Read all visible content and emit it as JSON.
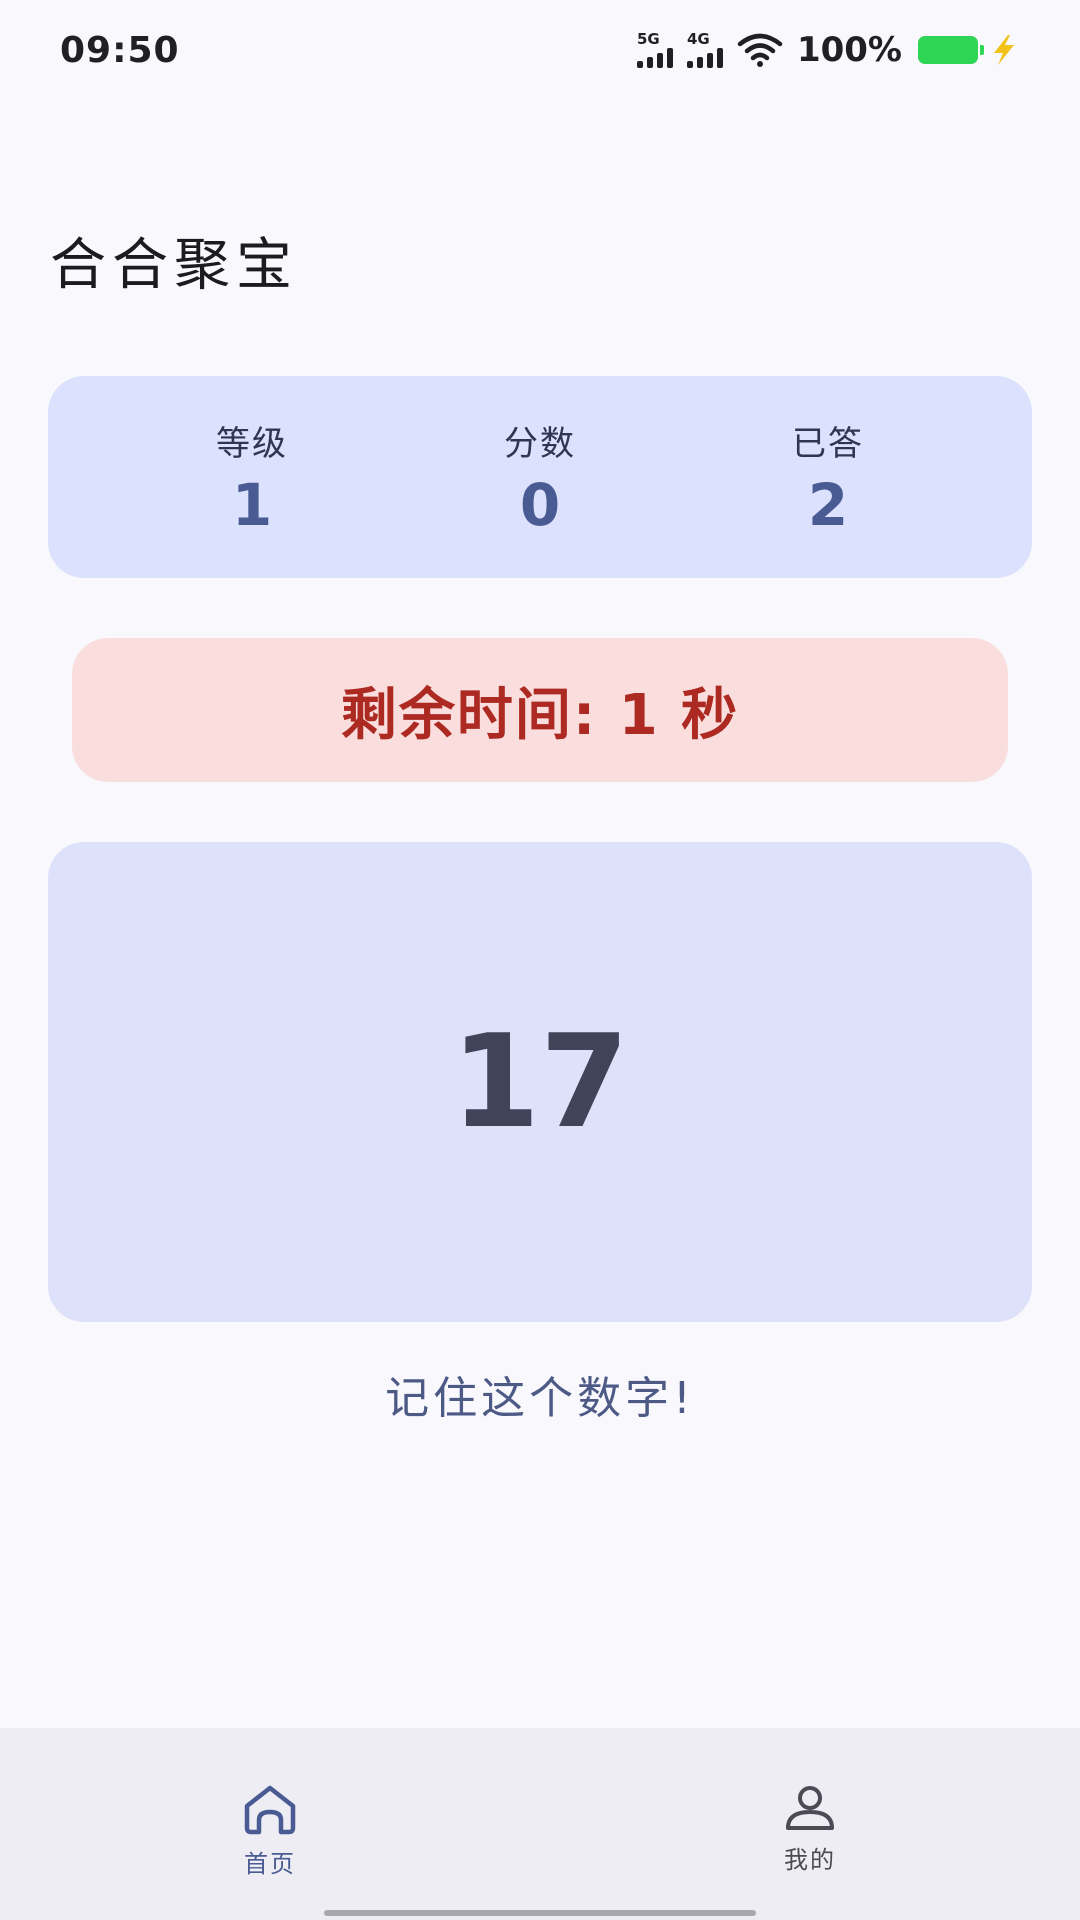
{
  "status_bar": {
    "time": "09:50",
    "signal1_label": "5G",
    "signal2_label": "4G",
    "battery_percent": "100%",
    "battery_color": "#2fd555",
    "charging_icon_color": "#f2c21a"
  },
  "app": {
    "title": "合合聚宝"
  },
  "stats": {
    "level_label": "等级",
    "level_value": "1",
    "score_label": "分数",
    "score_value": "0",
    "answered_label": "已答",
    "answered_value": "2"
  },
  "timer": {
    "text": "剩余时间: 1 秒"
  },
  "game": {
    "number": "17",
    "hint": "记住这个数字!"
  },
  "bottom_nav": {
    "items": [
      {
        "label": "首页",
        "icon": "home-icon",
        "active": true
      },
      {
        "label": "我的",
        "icon": "profile-icon",
        "active": false
      }
    ],
    "active_color": "#4a5a92"
  }
}
